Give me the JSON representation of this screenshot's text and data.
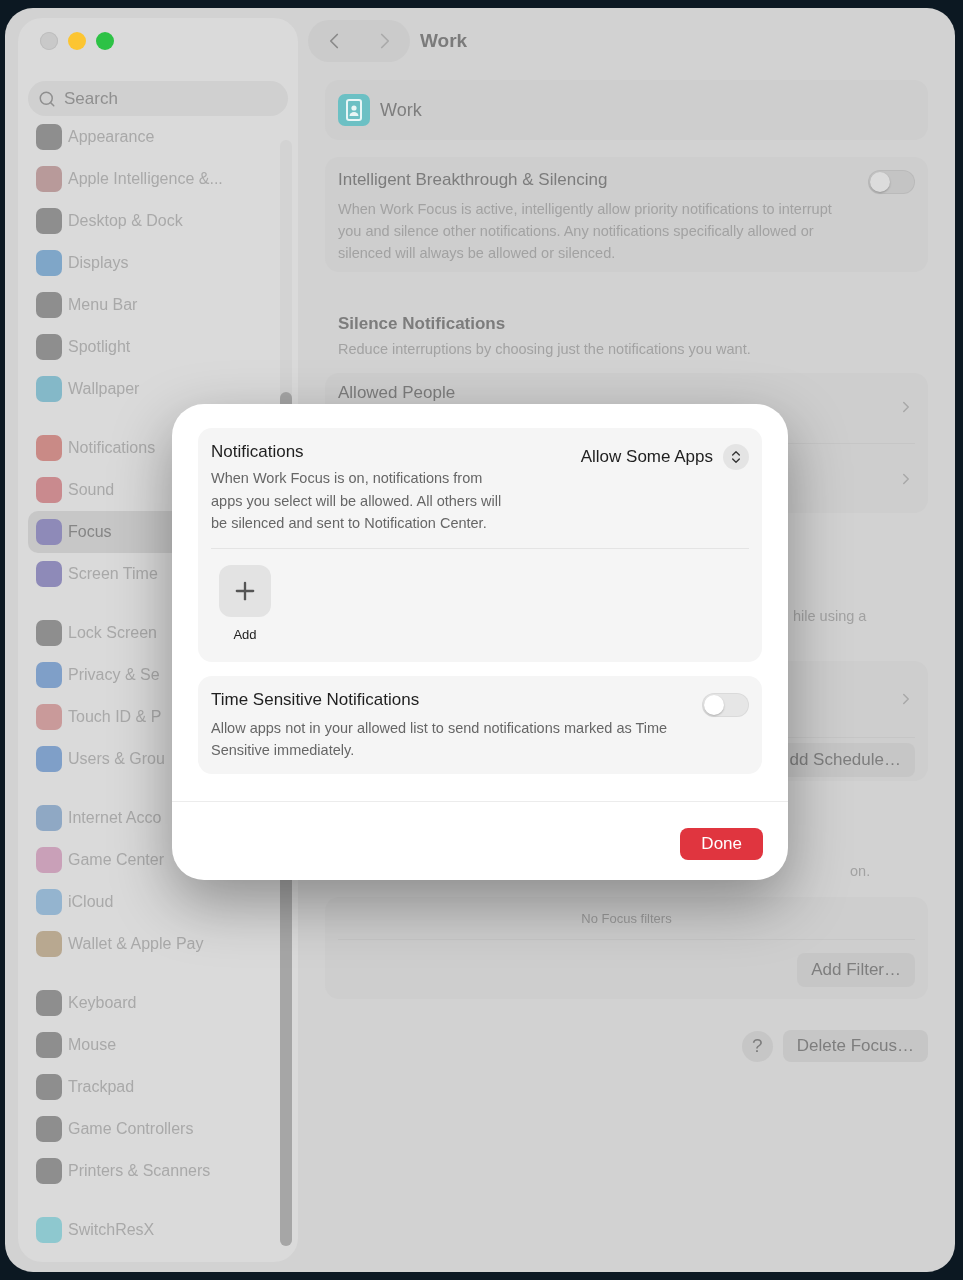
{
  "sidebar": {
    "search": {
      "placeholder": "Search"
    },
    "groups": [
      {
        "items": [
          {
            "label": "Appearance",
            "selected": false,
            "color": "#8e8e8e"
          },
          {
            "label": "Apple Intelligence &...",
            "selected": false,
            "color": "#b89a9a"
          },
          {
            "label": "Desktop & Dock",
            "selected": false,
            "color": "#8e8e8e"
          },
          {
            "label": "Displays",
            "selected": false,
            "color": "#7fa6c8"
          },
          {
            "label": "Menu Bar",
            "selected": false,
            "color": "#8e8e8e"
          },
          {
            "label": "Spotlight",
            "selected": false,
            "color": "#8e8e8e"
          },
          {
            "label": "Wallpaper",
            "selected": false,
            "color": "#84b8c8"
          }
        ]
      },
      {
        "items": [
          {
            "label": "Notifications",
            "selected": false,
            "color": "#c98a86"
          },
          {
            "label": "Sound",
            "selected": false,
            "color": "#c98a8e"
          },
          {
            "label": "Focus",
            "selected": true,
            "color": "#8e8ab8"
          },
          {
            "label": "Screen Time",
            "selected": false,
            "color": "#8e8ab8"
          }
        ]
      },
      {
        "items": [
          {
            "label": "Lock Screen",
            "selected": false,
            "color": "#8e8e8e"
          },
          {
            "label": "Privacy & Se",
            "selected": false,
            "color": "#7f9fc8"
          },
          {
            "label": "Touch ID & P",
            "selected": false,
            "color": "#c99a9a"
          },
          {
            "label": "Users & Grou",
            "selected": false,
            "color": "#7f9fc8"
          }
        ]
      },
      {
        "items": [
          {
            "label": "Internet Acco",
            "selected": false,
            "color": "#8fa8c4"
          },
          {
            "label": "Game Center",
            "selected": false,
            "color": "#c9a0b8"
          },
          {
            "label": "iCloud",
            "selected": false,
            "color": "#94b4cf"
          },
          {
            "label": "Wallet & Apple Pay",
            "selected": false,
            "color": "#b8a890"
          }
        ]
      },
      {
        "items": [
          {
            "label": "Keyboard",
            "selected": false,
            "color": "#8e8e8e"
          },
          {
            "label": "Mouse",
            "selected": false,
            "color": "#8e8e8e"
          },
          {
            "label": "Trackpad",
            "selected": false,
            "color": "#8e8e8e"
          },
          {
            "label": "Game Controllers",
            "selected": false,
            "color": "#8e8e8e"
          },
          {
            "label": "Printers & Scanners",
            "selected": false,
            "color": "#8e8e8e"
          }
        ]
      },
      {
        "items": [
          {
            "label": "SwitchResX",
            "selected": false,
            "color": "#8ec8cf"
          }
        ]
      }
    ]
  },
  "header": {
    "title": "Work"
  },
  "focus_card": {
    "name": "Work"
  },
  "breakthrough": {
    "title": "Intelligent Breakthrough & Silencing",
    "description": "When Work Focus is active, intelligently allow priority notifications to interrupt you and silence other notifications. Any notifications specifically allowed or silenced will always be allowed or silenced.",
    "on": false
  },
  "silence": {
    "heading": "Silence Notifications",
    "description": "Reduce interruptions by choosing just the notifications you want."
  },
  "allowed_rows": [
    {
      "label": "Allowed People"
    }
  ],
  "schedule": {
    "description_fragment": "hile using a",
    "add_button": "dd Schedule…"
  },
  "filters": {
    "description_fragment": "on.",
    "empty_text": "No Focus filters",
    "add_button": "Add Filter…"
  },
  "footer": {
    "help": "?",
    "delete_button": "Delete Focus…"
  },
  "dialog": {
    "notifications": {
      "title": "Notifications",
      "description": "When Work Focus is on, notifications from apps you select will be allowed. All others will be silenced and sent to Notification Center.",
      "mode": "Allow Some Apps",
      "add_label": "Add"
    },
    "time_sensitive": {
      "title": "Time Sensitive Notifications",
      "description": "Allow apps not in your allowed list to send notifications marked as Time Sensitive immediately.",
      "on": false
    },
    "done_button": "Done"
  }
}
